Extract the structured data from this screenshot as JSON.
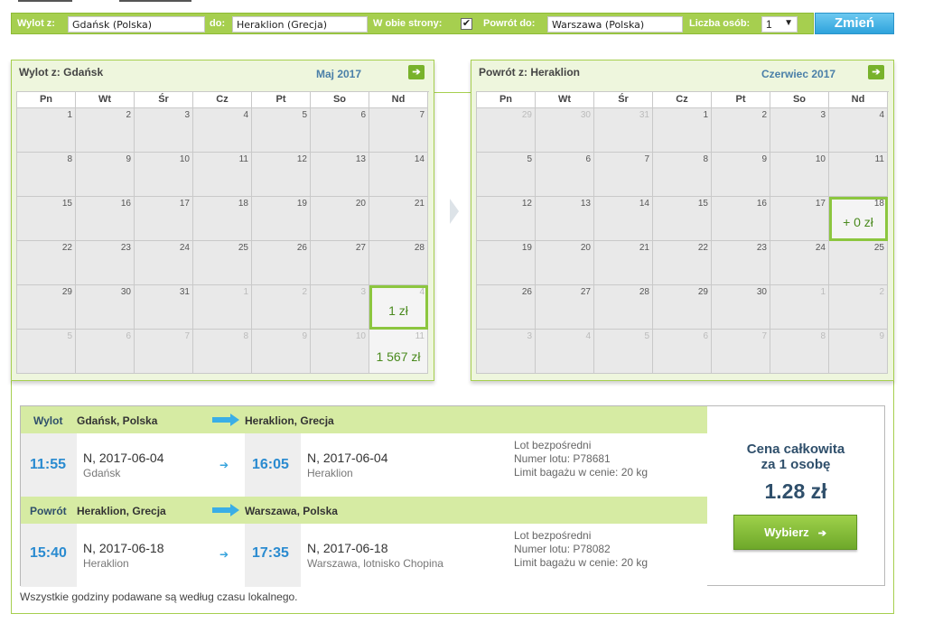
{
  "search": {
    "from_label": "Wylot z:",
    "from_value": "Gdańsk (Polska)",
    "to_label": "do:",
    "to_value": "Heraklion (Grecja)",
    "roundtrip_label": "W obie strony:",
    "roundtrip_checked": "✔",
    "return_label": "Powrót do:",
    "return_value": "Warszawa (Polska)",
    "persons_label": "Liczba osób:",
    "persons_value": "1",
    "persons_arrow": "▼",
    "change_button": "Zmień"
  },
  "calendar_out": {
    "title": "Wylot z: Gdańsk",
    "month": "Maj 2017",
    "next_icon": "arrow-right-icon",
    "weekdays": [
      "Pn",
      "Wt",
      "Śr",
      "Cz",
      "Pt",
      "So",
      "Nd"
    ],
    "days": [
      {
        "n": "1",
        "muted": false,
        "price": ""
      },
      {
        "n": "2",
        "muted": false,
        "price": ""
      },
      {
        "n": "3",
        "muted": false,
        "price": ""
      },
      {
        "n": "4",
        "muted": false,
        "price": ""
      },
      {
        "n": "5",
        "muted": false,
        "price": ""
      },
      {
        "n": "6",
        "muted": false,
        "price": ""
      },
      {
        "n": "7",
        "muted": false,
        "price": ""
      },
      {
        "n": "8",
        "muted": false,
        "price": ""
      },
      {
        "n": "9",
        "muted": false,
        "price": ""
      },
      {
        "n": "10",
        "muted": false,
        "price": ""
      },
      {
        "n": "11",
        "muted": false,
        "price": ""
      },
      {
        "n": "12",
        "muted": false,
        "price": ""
      },
      {
        "n": "13",
        "muted": false,
        "price": ""
      },
      {
        "n": "14",
        "muted": false,
        "price": ""
      },
      {
        "n": "15",
        "muted": false,
        "price": ""
      },
      {
        "n": "16",
        "muted": false,
        "price": ""
      },
      {
        "n": "17",
        "muted": false,
        "price": ""
      },
      {
        "n": "18",
        "muted": false,
        "price": ""
      },
      {
        "n": "19",
        "muted": false,
        "price": ""
      },
      {
        "n": "20",
        "muted": false,
        "price": ""
      },
      {
        "n": "21",
        "muted": false,
        "price": ""
      },
      {
        "n": "22",
        "muted": false,
        "price": ""
      },
      {
        "n": "23",
        "muted": false,
        "price": ""
      },
      {
        "n": "24",
        "muted": false,
        "price": ""
      },
      {
        "n": "25",
        "muted": false,
        "price": ""
      },
      {
        "n": "26",
        "muted": false,
        "price": ""
      },
      {
        "n": "27",
        "muted": false,
        "price": ""
      },
      {
        "n": "28",
        "muted": false,
        "price": ""
      },
      {
        "n": "29",
        "muted": false,
        "price": ""
      },
      {
        "n": "30",
        "muted": false,
        "price": ""
      },
      {
        "n": "31",
        "muted": false,
        "price": ""
      },
      {
        "n": "1",
        "muted": true,
        "price": ""
      },
      {
        "n": "2",
        "muted": true,
        "price": ""
      },
      {
        "n": "3",
        "muted": true,
        "price": ""
      },
      {
        "n": "4",
        "muted": true,
        "price": "1 zł",
        "selected": true
      },
      {
        "n": "5",
        "muted": true,
        "price": ""
      },
      {
        "n": "6",
        "muted": true,
        "price": ""
      },
      {
        "n": "7",
        "muted": true,
        "price": ""
      },
      {
        "n": "8",
        "muted": true,
        "price": ""
      },
      {
        "n": "9",
        "muted": true,
        "price": ""
      },
      {
        "n": "10",
        "muted": true,
        "price": ""
      },
      {
        "n": "11",
        "muted": true,
        "price": "1 567 zł"
      }
    ]
  },
  "calendar_ret": {
    "title": "Powrót z: Heraklion",
    "month": "Czerwiec 2017",
    "next_icon": "arrow-right-icon",
    "weekdays": [
      "Pn",
      "Wt",
      "Śr",
      "Cz",
      "Pt",
      "So",
      "Nd"
    ],
    "days": [
      {
        "n": "29",
        "muted": true,
        "price": ""
      },
      {
        "n": "30",
        "muted": true,
        "price": ""
      },
      {
        "n": "31",
        "muted": true,
        "price": ""
      },
      {
        "n": "1",
        "muted": false,
        "price": ""
      },
      {
        "n": "2",
        "muted": false,
        "price": ""
      },
      {
        "n": "3",
        "muted": false,
        "price": ""
      },
      {
        "n": "4",
        "muted": false,
        "price": ""
      },
      {
        "n": "5",
        "muted": false,
        "price": ""
      },
      {
        "n": "6",
        "muted": false,
        "price": ""
      },
      {
        "n": "7",
        "muted": false,
        "price": ""
      },
      {
        "n": "8",
        "muted": false,
        "price": ""
      },
      {
        "n": "9",
        "muted": false,
        "price": ""
      },
      {
        "n": "10",
        "muted": false,
        "price": ""
      },
      {
        "n": "11",
        "muted": false,
        "price": ""
      },
      {
        "n": "12",
        "muted": false,
        "price": ""
      },
      {
        "n": "13",
        "muted": false,
        "price": ""
      },
      {
        "n": "14",
        "muted": false,
        "price": ""
      },
      {
        "n": "15",
        "muted": false,
        "price": ""
      },
      {
        "n": "16",
        "muted": false,
        "price": ""
      },
      {
        "n": "17",
        "muted": false,
        "price": ""
      },
      {
        "n": "18",
        "muted": false,
        "price": "+ 0 zł",
        "selected": true
      },
      {
        "n": "19",
        "muted": false,
        "price": ""
      },
      {
        "n": "20",
        "muted": false,
        "price": ""
      },
      {
        "n": "21",
        "muted": false,
        "price": ""
      },
      {
        "n": "22",
        "muted": false,
        "price": ""
      },
      {
        "n": "23",
        "muted": false,
        "price": ""
      },
      {
        "n": "24",
        "muted": false,
        "price": ""
      },
      {
        "n": "25",
        "muted": false,
        "price": ""
      },
      {
        "n": "26",
        "muted": false,
        "price": ""
      },
      {
        "n": "27",
        "muted": false,
        "price": ""
      },
      {
        "n": "28",
        "muted": false,
        "price": ""
      },
      {
        "n": "29",
        "muted": false,
        "price": ""
      },
      {
        "n": "30",
        "muted": false,
        "price": ""
      },
      {
        "n": "1",
        "muted": true,
        "price": ""
      },
      {
        "n": "2",
        "muted": true,
        "price": ""
      },
      {
        "n": "3",
        "muted": true,
        "price": ""
      },
      {
        "n": "4",
        "muted": true,
        "price": ""
      },
      {
        "n": "5",
        "muted": true,
        "price": ""
      },
      {
        "n": "6",
        "muted": true,
        "price": ""
      },
      {
        "n": "7",
        "muted": true,
        "price": ""
      },
      {
        "n": "8",
        "muted": true,
        "price": ""
      },
      {
        "n": "9",
        "muted": true,
        "price": ""
      }
    ]
  },
  "outbound": {
    "label": "Wylot",
    "from": "Gdańsk, Polska",
    "to": "Heraklion, Grecja",
    "dep_time": "11:55",
    "dep_date": "N, 2017-06-04",
    "dep_place": "Gdańsk",
    "arr_time": "16:05",
    "arr_date": "N, 2017-06-04",
    "arr_place": "Heraklion",
    "info_1": "Lot bezpośredni",
    "info_2": "Numer lotu: P78681",
    "info_3": "Limit bagażu w cenie: 20 kg"
  },
  "return": {
    "label": "Powrót",
    "from": "Heraklion, Grecja",
    "to": "Warszawa, Polska",
    "dep_time": "15:40",
    "dep_date": "N, 2017-06-18",
    "dep_place": "Heraklion",
    "arr_time": "17:35",
    "arr_date": "N, 2017-06-18",
    "arr_place": "Warszawa, lotnisko Chopina",
    "info_1": "Lot bezpośredni",
    "info_2": "Numer lotu: P78082",
    "info_3": "Limit bagażu w cenie: 20 kg"
  },
  "price": {
    "title_line1": "Cena całkowita",
    "title_line2": "za 1 osobę",
    "amount": "1.28 zł",
    "select_button": "Wybierz",
    "select_arrow": "➔"
  },
  "small_arrow": "➔",
  "footnote": "Wszystkie godziny podawane są według czasu lokalnego.",
  "colors": {
    "accent_green": "#a6cf4f",
    "price_blue": "#2f4f6b",
    "time_blue": "#2a8bd0",
    "button_blue": "#2ea3dc"
  }
}
